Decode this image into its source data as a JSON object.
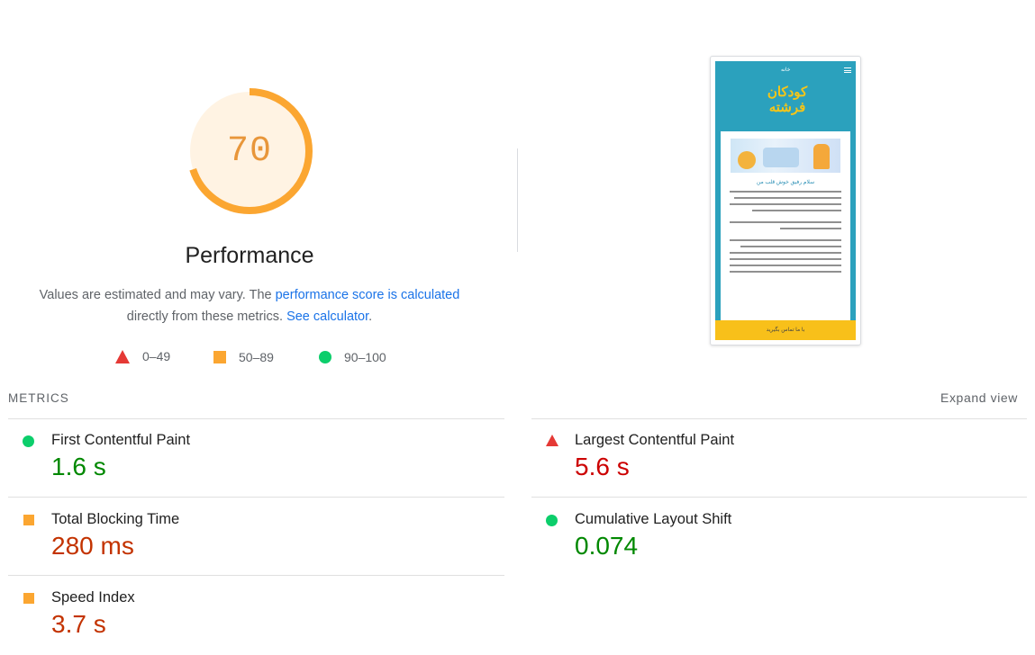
{
  "gauge": {
    "score": "70",
    "fraction": 0.7,
    "color": "#fba631",
    "track_color": "#fff3e3"
  },
  "performance": {
    "title": "Performance",
    "desc_before": "Values are estimated and may vary. The ",
    "link_score": "performance score is calculated",
    "desc_middle": "directly from these metrics. ",
    "link_calculator": "See calculator",
    "desc_end": "."
  },
  "legend": [
    {
      "shape": "triangle-icon",
      "label": "0–49",
      "color": "#e53935"
    },
    {
      "shape": "square-icon",
      "label": "50–89",
      "color": "#fba631"
    },
    {
      "shape": "circle-icon",
      "label": "90–100",
      "color": "#0cce6b"
    }
  ],
  "screenshot": {
    "home_label": "خانه",
    "logo_text": "کودکان فرشته",
    "card_title": "سلام رفیق خوش قلب من",
    "cta_label": "با ما تماس بگیرید"
  },
  "metrics": {
    "header": "METRICS",
    "expand_label": "Expand view",
    "items": [
      {
        "label": "First Contentful Paint",
        "value": "1.6 s",
        "rating": "good"
      },
      {
        "label": "Largest Contentful Paint",
        "value": "5.6 s",
        "rating": "bad"
      },
      {
        "label": "Total Blocking Time",
        "value": "280 ms",
        "rating": "average"
      },
      {
        "label": "Cumulative Layout Shift",
        "value": "0.074",
        "rating": "good"
      },
      {
        "label": "Speed Index",
        "value": "3.7 s",
        "rating": "average"
      }
    ]
  }
}
